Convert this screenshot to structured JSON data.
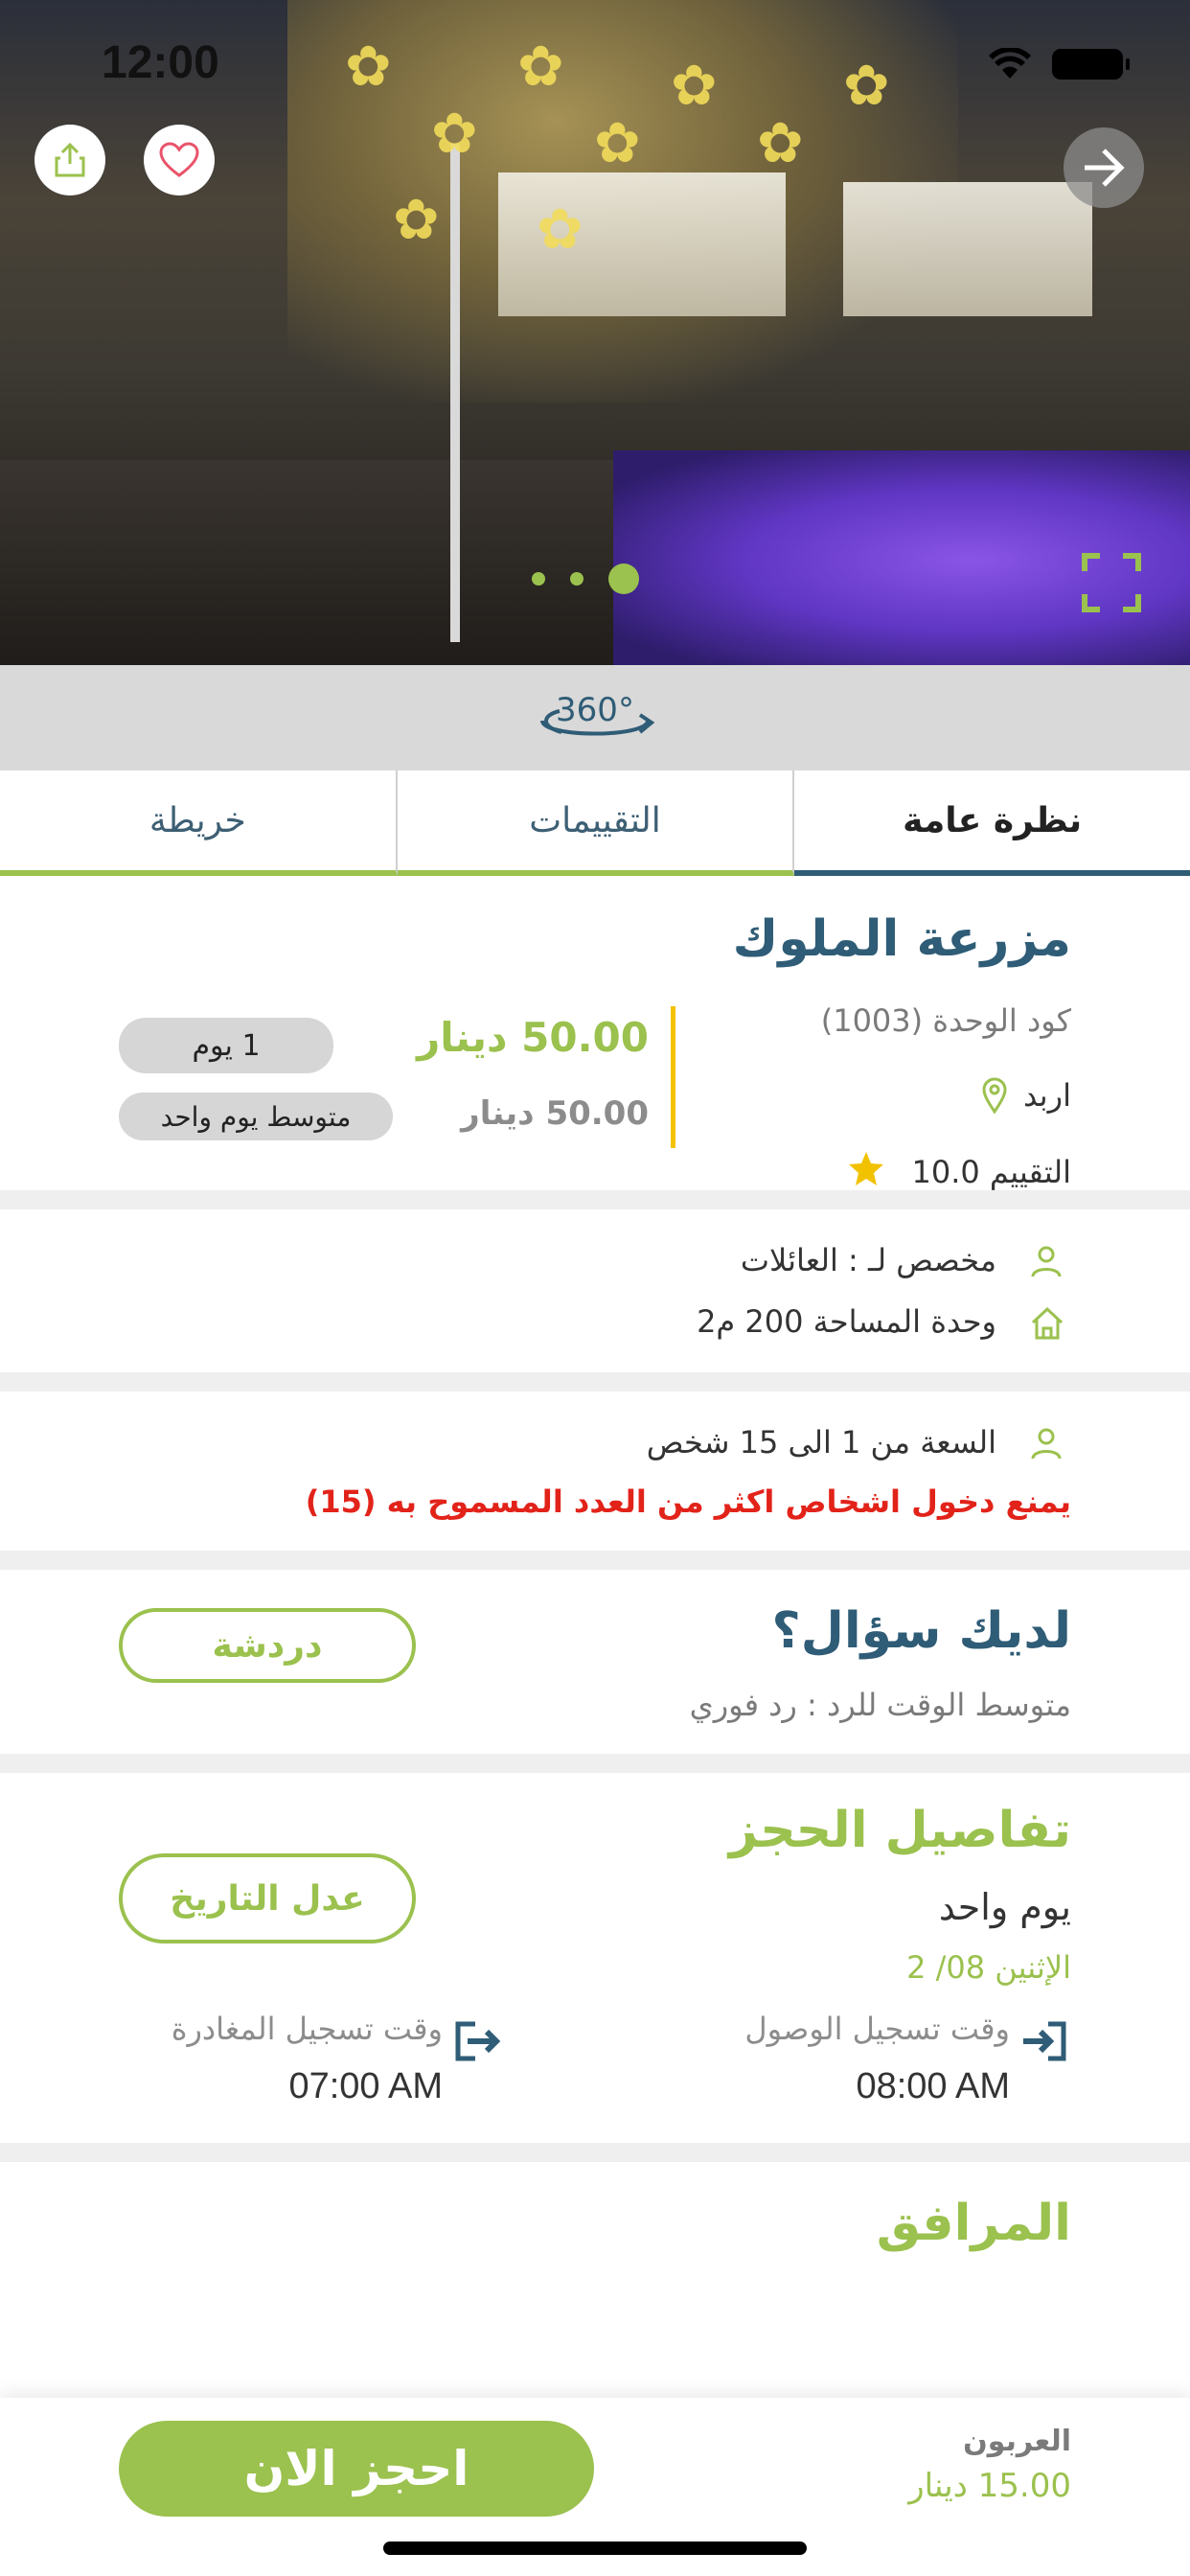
{
  "status_bar": {
    "time": "12:00"
  },
  "gallery": {
    "page_count": 3,
    "active_page": 3,
    "badge_360": "360°"
  },
  "tabs": [
    {
      "label": "نظرة عامة",
      "active": true
    },
    {
      "label": "التقييمات",
      "active": false
    },
    {
      "label": "خريطة",
      "active": false
    }
  ],
  "overview": {
    "name": "مزرعة الملوك",
    "code": "كود الوحدة (1003)",
    "city": "اربد",
    "rating": "التقييم 10.0",
    "price": "50.00 دينار",
    "price_avg": "50.00 دينار",
    "duration_pill": "1 يوم",
    "avg_pill": "متوسط يوم واحد"
  },
  "details": {
    "dedicated_for": "مخصص لـ :  العائلات",
    "area": "وحدة المساحة 200 م2"
  },
  "capacity": {
    "text": "السعة من 1  الى 15 شخص",
    "warning": "يمنع دخول اشخاص اكثر من العدد المسموح به (15)"
  },
  "question": {
    "title": "لديك سؤال؟",
    "response_time": "متوسط الوقت للرد  : رد فوري",
    "chat_button": "دردشة"
  },
  "booking": {
    "title": "تفاصيل الحجز",
    "duration": "يوم واحد",
    "date": "الإثنين  08/ 2",
    "edit_button": "عدل التاريخ",
    "checkin_label": "وقت تسجيل الوصول",
    "checkin_time": "08:00 AM",
    "checkout_label": "وقت تسجيل المغادرة",
    "checkout_time": "07:00 AM"
  },
  "amenities": {
    "title": "المرافق"
  },
  "footer": {
    "deposit_label": "العربون",
    "deposit_value": "15.00 دينار",
    "book_button": "احجز الان"
  },
  "colors": {
    "green": "#9bc14e",
    "navy": "#2f5c76",
    "red": "#e2231a",
    "star": "#f2c200"
  }
}
